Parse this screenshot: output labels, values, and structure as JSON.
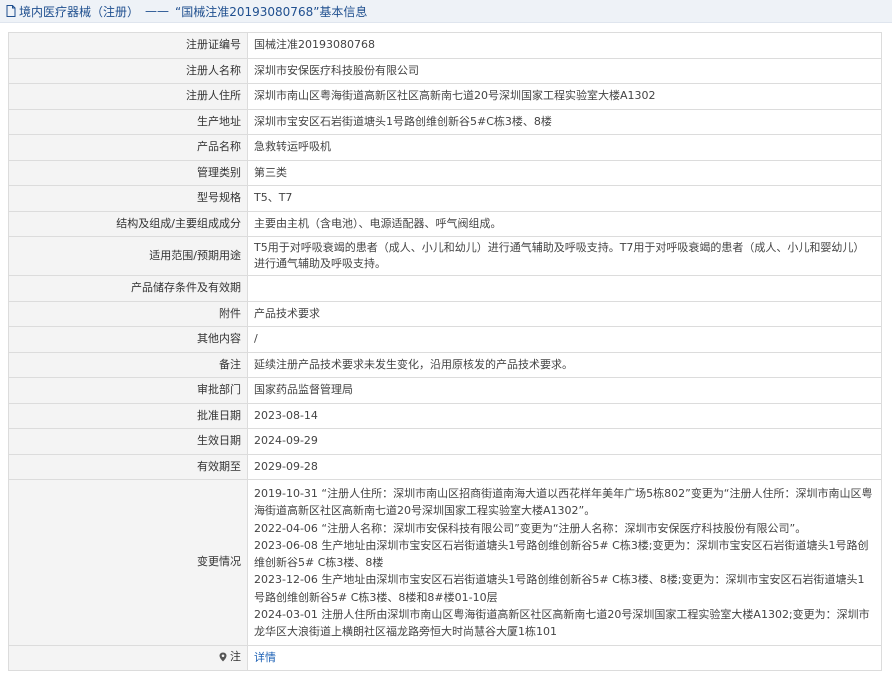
{
  "header": {
    "title": "境内医疗器械（注册）",
    "dash": "——",
    "subtitle": "“国械注准20193080768”基本信息"
  },
  "fields": [
    {
      "label": "注册证编号",
      "value": "国械注准20193080768"
    },
    {
      "label": "注册人名称",
      "value": "深圳市安保医疗科技股份有限公司"
    },
    {
      "label": "注册人住所",
      "value": "深圳市南山区粤海街道高新区社区高新南七道20号深圳国家工程实验室大楼A1302"
    },
    {
      "label": "生产地址",
      "value": "深圳市宝安区石岩街道塘头1号路创维创新谷5#C栋3楼、8楼"
    },
    {
      "label": "产品名称",
      "value": "急救转运呼吸机"
    },
    {
      "label": "管理类别",
      "value": "第三类"
    },
    {
      "label": "型号规格",
      "value": "T5、T7"
    },
    {
      "label": "结构及组成/主要组成成分",
      "value": "主要由主机（含电池）、电源适配器、呼气阀组成。"
    },
    {
      "label": "适用范围/预期用途",
      "value": "T5用于对呼吸衰竭的患者（成人、小儿和幼儿）进行通气辅助及呼吸支持。T7用于对呼吸衰竭的患者（成人、小儿和婴幼儿）进行通气辅助及呼吸支持。"
    },
    {
      "label": "产品储存条件及有效期",
      "value": ""
    },
    {
      "label": "附件",
      "value": "产品技术要求"
    },
    {
      "label": "其他内容",
      "value": "/"
    },
    {
      "label": "备注",
      "value": "延续注册产品技术要求未发生变化，沿用原核发的产品技术要求。"
    },
    {
      "label": "审批部门",
      "value": "国家药品监督管理局"
    },
    {
      "label": "批准日期",
      "value": "2023-08-14"
    },
    {
      "label": "生效日期",
      "value": "2024-09-29"
    },
    {
      "label": "有效期至",
      "value": "2029-09-28"
    }
  ],
  "changes": {
    "label": "变更情况",
    "entries": [
      "2019-10-31 “注册人住所：深圳市南山区招商街道南海大道以西花样年美年广场5栋802”变更为“注册人住所：深圳市南山区粤海街道高新区社区高新南七道20号深圳国家工程实验室大楼A1302”。",
      "2022-04-06 “注册人名称：深圳市安保科技有限公司”变更为“注册人名称：深圳市安保医疗科技股份有限公司”。",
      "2023-06-08 生产地址由深圳市宝安区石岩街道塘头1号路创维创新谷5# C栋3楼;变更为：深圳市宝安区石岩街道塘头1号路创维创新谷5# C栋3楼、8楼",
      "2023-12-06 生产地址由深圳市宝安区石岩街道塘头1号路创维创新谷5# C栋3楼、8楼;变更为：深圳市宝安区石岩街道塘头1号路创维创新谷5# C栋3楼、8楼和8#楼01-10层",
      "2024-03-01 注册人住所由深圳市南山区粤海街道高新区社区高新南七道20号深圳国家工程实验室大楼A1302;变更为：深圳市龙华区大浪街道上横朗社区福龙路旁恒大时尚慧谷大厦1栋101"
    ]
  },
  "note": {
    "label": "注",
    "link": "详情"
  },
  "colors": {
    "header_text": "#1f4f8f",
    "label_bg": "#f4f4f4",
    "border": "#dcdcdc",
    "link": "#1a5fb4"
  }
}
